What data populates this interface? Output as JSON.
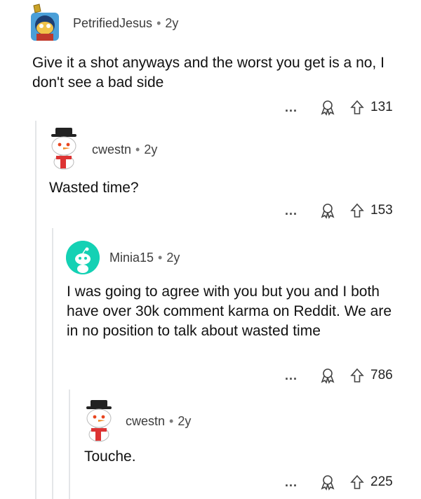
{
  "comments": [
    {
      "username": "PetrifiedJesus",
      "age": "2y",
      "text": "Give it a shot anyways and the worst you get is a no, I don't see a bad side",
      "more": "...",
      "votes": "131"
    },
    {
      "username": "cwestn",
      "age": "2y",
      "text": "Wasted time?",
      "more": "...",
      "votes": "153"
    },
    {
      "username": "Minia15",
      "age": "2y",
      "text": "I was going to agree with you but you and I both have over 30k comment karma on Reddit. We are in no position to talk about wasted time",
      "more": "...",
      "votes": "786"
    },
    {
      "username": "cwestn",
      "age": "2y",
      "text": "Touche.",
      "more": "...",
      "votes": "225"
    }
  ],
  "separator": "•",
  "colors": {
    "minia_avatar": "#14d1b4",
    "thread_line": "#e4e6e8"
  }
}
